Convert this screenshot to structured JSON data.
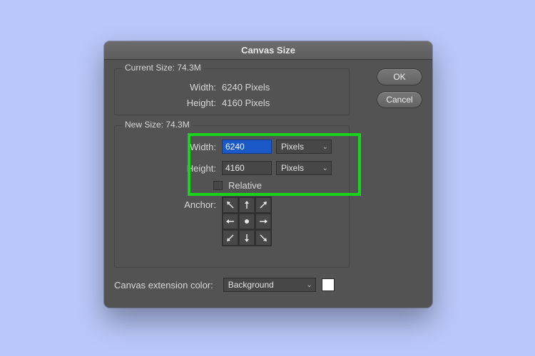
{
  "dialog": {
    "title": "Canvas Size",
    "buttons": {
      "ok": "OK",
      "cancel": "Cancel"
    }
  },
  "current": {
    "legend": "Current Size: 74.3M",
    "width_label": "Width:",
    "width_value": "6240 Pixels",
    "height_label": "Height:",
    "height_value": "4160 Pixels"
  },
  "new": {
    "legend": "New Size: 74.3M",
    "width_label": "Width:",
    "width_value": "6240",
    "width_unit": "Pixels",
    "height_label": "Height:",
    "height_value": "4160",
    "height_unit": "Pixels",
    "relative_label": "Relative",
    "anchor_label": "Anchor:"
  },
  "extension": {
    "label": "Canvas extension color:",
    "value": "Background",
    "swatch": "#ffffff"
  }
}
